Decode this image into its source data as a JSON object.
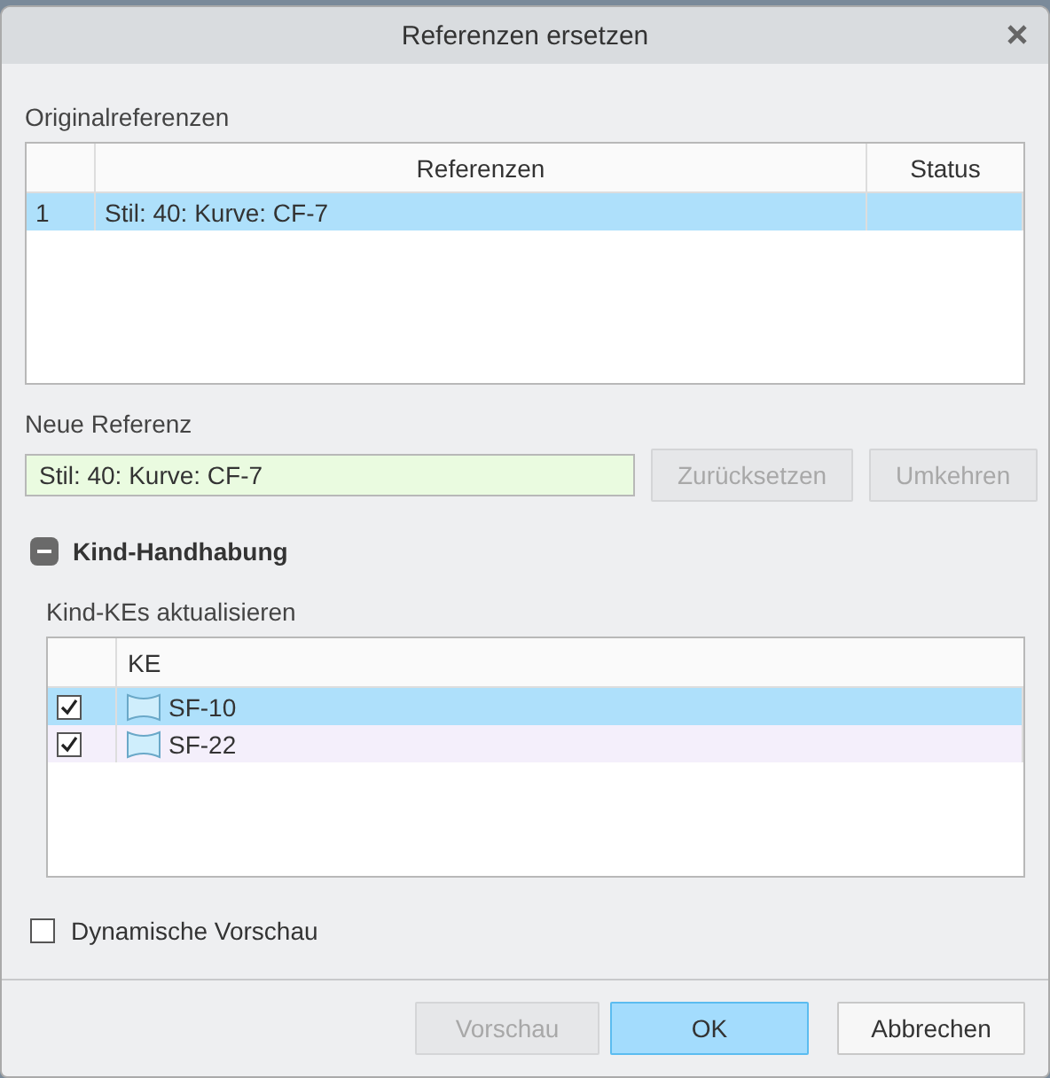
{
  "window": {
    "title": "Referenzen ersetzen"
  },
  "original_references": {
    "label": "Originalreferenzen",
    "columns": [
      "Referenzen",
      "Status"
    ],
    "rows": [
      {
        "index": "1",
        "reference": "Stil: 40: Kurve: CF-7",
        "selected": true
      }
    ]
  },
  "new_reference": {
    "label": "Neue Referenz",
    "value": "Stil: 40: Kurve: CF-7",
    "buttons": [
      {
        "label": "Zurücksetzen",
        "disabled": true
      },
      {
        "label": "Umkehren",
        "disabled": true
      }
    ]
  },
  "child_handling": {
    "title": "Kind-Handhabung",
    "expanded": true,
    "sublabel": "Kind-KEs aktualisieren",
    "columns": [
      "KE"
    ],
    "rows": [
      {
        "checked": true,
        "name": "SF-10",
        "selected": true
      },
      {
        "checked": true,
        "name": "SF-22",
        "selected": false
      }
    ]
  },
  "dynamic_preview": {
    "label": "Dynamische Vorschau",
    "checked": false
  },
  "footer_buttons": [
    {
      "label": "Vorschau",
      "kind": "normal",
      "disabled": true
    },
    {
      "label": "OK",
      "kind": "primary",
      "disabled": false
    },
    {
      "label": "Abbrechen",
      "kind": "normal",
      "disabled": false
    }
  ]
}
